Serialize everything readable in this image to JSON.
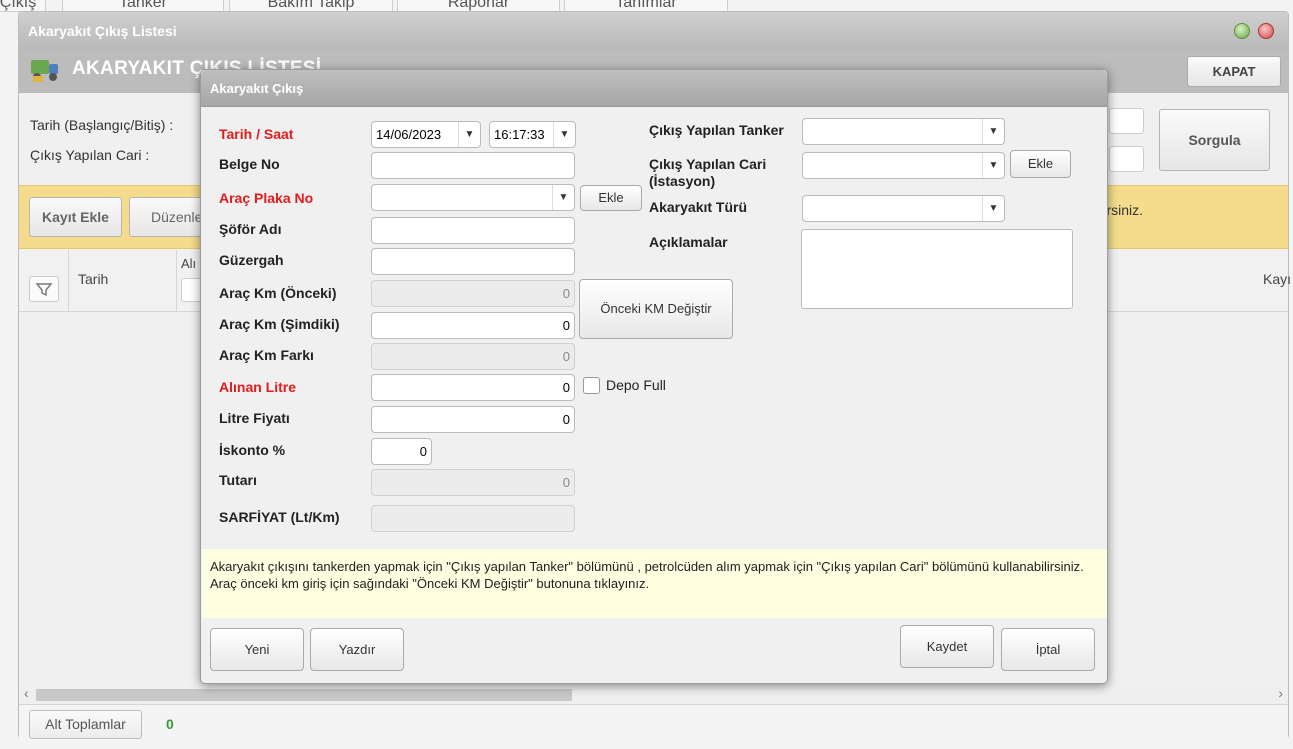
{
  "top_tabs": [
    "Çıkış",
    "Tanker",
    "Bakım Takip",
    "Raporlar",
    "Tanımlar"
  ],
  "window": {
    "title": "Akaryakıt Çıkış Listesi",
    "header_title": "AKARYAKIT ÇIKIŞ LİSTESİ",
    "close_label": "KAPAT",
    "filter_date_label": "Tarih (Başlangıç/Bitiş) :",
    "filter_cari_label": "Çıkış Yapılan Cari :",
    "query_label": "Sorgula",
    "add_record_label": "Kayıt Ekle",
    "edit_label": "Düzenle",
    "toolbar_hint_tail": "rsiniz.",
    "col_tarih": "Tarih",
    "col_alinan": "Alı",
    "col_kayit": "Kayı",
    "subtotals_label": "Alt Toplamlar",
    "subtotals_value": "0"
  },
  "modal": {
    "title": "Akaryakıt Çıkış",
    "labels": {
      "tarih_saat": "Tarih / Saat",
      "belge_no": "Belge No",
      "arac_plaka": "Araç Plaka No",
      "sofor": "Şöför Adı",
      "guzergah": "Güzergah",
      "km_onceki": "Araç Km (Önceki)",
      "km_simdiki": "Araç Km (Şimdiki)",
      "km_farki": "Araç Km Farkı",
      "alinan_litre": "Alınan Litre",
      "litre_fiyati": "Litre Fiyatı",
      "iskonto": "İskonto %",
      "tutari": "Tutarı",
      "sarfiyat": "SARFİYAT (Lt/Km)",
      "tanker": "Çıkış Yapılan Tanker",
      "cari_line1": "Çıkış Yapılan Cari",
      "cari_line2": "(İstasyon)",
      "yakit_turu": "Akaryakıt Türü",
      "aciklamalar": "Açıklamalar",
      "depo_full": "Depo Full"
    },
    "values": {
      "date": "14/06/2023",
      "time": "16:17:33",
      "km_onceki": "0",
      "km_simdiki": "0",
      "km_farki": "0",
      "alinan_litre": "0",
      "litre_fiyati": "0",
      "iskonto": "0",
      "tutari": "0"
    },
    "buttons": {
      "ekle_plaka": "Ekle",
      "ekle_cari": "Ekle",
      "onceki_km": "Önceki KM Değiştir",
      "yeni": "Yeni",
      "yazdir": "Yazdır",
      "kaydet": "Kaydet",
      "iptal": "İptal"
    },
    "info_text": "Akaryakıt çıkışını tankerden yapmak için \"Çıkış yapılan Tanker\" bölümünü , petrolcüden alım yapmak için \"Çıkış yapılan Cari\" bölümünü kullanabilirsiniz. Araç önceki km giriş için sağındaki \"Önceki KM Değiştir\" butonuna tıklayınız."
  },
  "colors": {
    "required_label": "#e21b1b",
    "toolbar_bg": "#f4dc8c",
    "info_bg": "#fefee0",
    "subtotal_value": "#3a9a3a"
  }
}
